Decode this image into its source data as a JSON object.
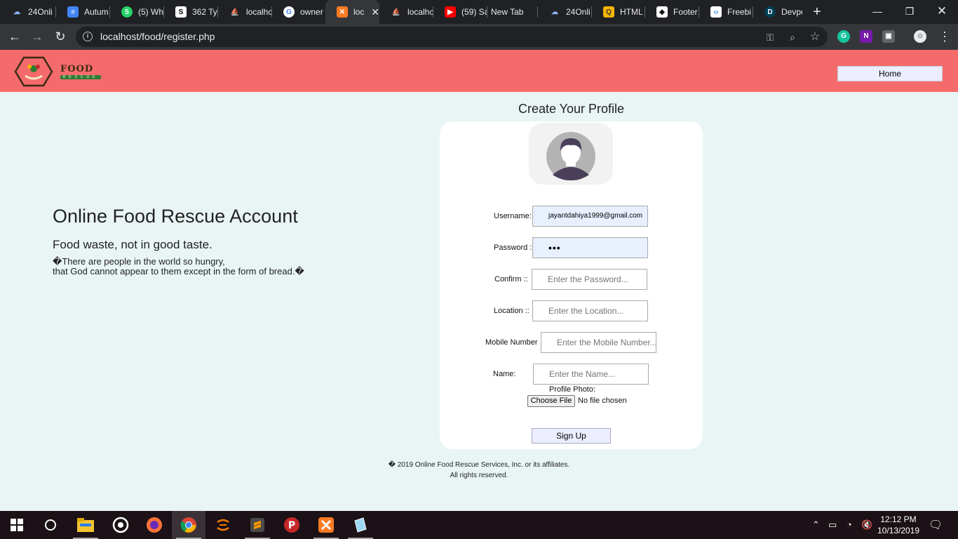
{
  "browser": {
    "tabs": [
      {
        "label": "24Onli",
        "icon": "clouds-icon",
        "color": "#8ab4f8"
      },
      {
        "label": "Autum",
        "icon": "docs-icon",
        "color": "#4285f4"
      },
      {
        "label": "(5) Wh",
        "icon": "whatsapp-icon",
        "color": "#25d366"
      },
      {
        "label": "362 Ty",
        "icon": "s-icon",
        "color": "#ffffff"
      },
      {
        "label": "localhc",
        "icon": "pma-icon",
        "color": "#e8a317"
      },
      {
        "label": "owner",
        "icon": "google-icon",
        "color": "#ffffff"
      },
      {
        "label": "loc",
        "icon": "xampp-icon",
        "color": "#fb7a24"
      },
      {
        "label": "localhc",
        "icon": "pma-icon",
        "color": "#e8a317"
      },
      {
        "label": "(59) Sa",
        "icon": "youtube-icon",
        "color": "#ff0000"
      },
      {
        "label": "New Tab",
        "icon": "",
        "color": ""
      },
      {
        "label": "24Onli",
        "icon": "clouds-icon",
        "color": "#8ab4f8"
      },
      {
        "label": "HTML",
        "icon": "html-icon",
        "color": "#f4b400"
      },
      {
        "label": "Footer",
        "icon": "codepen-icon",
        "color": "#ffffff"
      },
      {
        "label": "Freebi",
        "icon": "freebie-icon",
        "color": "#ffffff"
      },
      {
        "label": "Devpo",
        "icon": "devpost-icon",
        "color": "#003e54"
      }
    ],
    "new_tab_symbol": "+",
    "url": "localhost/food/register.php"
  },
  "site": {
    "logo_text": "FOOD",
    "logo_subtext": "RESCUE",
    "home_label": "Home"
  },
  "hero": {
    "title": "Online Food Rescue Account",
    "subtitle": "Food waste, not in good taste.",
    "quote_line1": "�There are people in the world so hungry,",
    "quote_line2": "that God cannot appear to them except in the form of bread.�"
  },
  "form": {
    "title": "Create Your Profile",
    "username_label": "Username:",
    "username_value": "jayantdahiya1999@gmail.com",
    "password_label": "Password :",
    "password_value": "•••",
    "confirm_label": "Confirm ::",
    "confirm_placeholder": "Enter the Password...",
    "location_label": "Location ::",
    "location_placeholder": "Enter the Location...",
    "mobile_label": "Mobile Number",
    "mobile_placeholder": "Enter the Mobile Number...",
    "name_label": "Name:",
    "name_placeholder": "Enter the Name...",
    "photo_label": "Profile Photo:",
    "choose_file_label": "Choose File",
    "no_file_text": "No file chosen",
    "signup_label": "Sign Up"
  },
  "footer": {
    "line1": "� 2019 Online Food Rescue Services, Inc. or its affiliates.",
    "line2": "All rights reserved."
  },
  "taskbar": {
    "time": "12:12 PM",
    "date": "10/13/2019"
  }
}
